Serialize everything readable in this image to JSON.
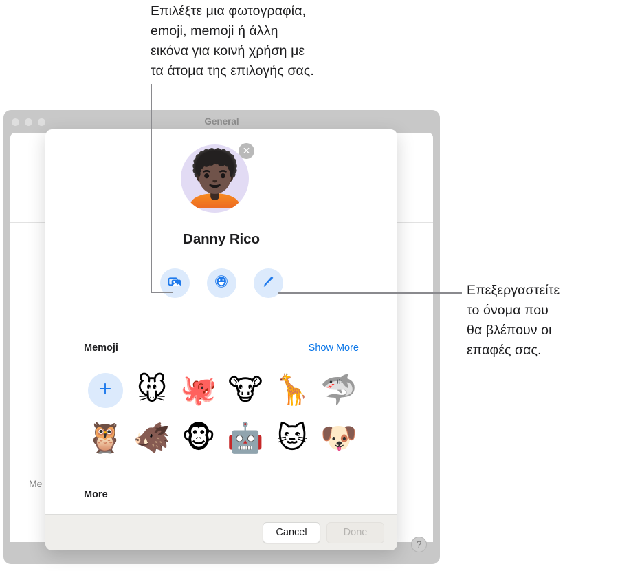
{
  "callouts": {
    "top": "Επιλέξτε μια φωτογραφία,\nemoji, memoji ή άλλη\nεικόνα για κοινή χρήση με\nτα άτομα της επιλογής σας.",
    "right": "Επεξεργαστείτε\nτο όνομα που\nθα βλέπουν οι\nεπαφές σας."
  },
  "background_window": {
    "title": "General",
    "me_label": "Me",
    "help_label": "?",
    "traffic_lights": [
      "close-dot",
      "minimize-dot",
      "maximize-dot"
    ]
  },
  "dialog": {
    "avatar": {
      "glyph": "🧑🏿‍🦱",
      "remove_label": "✕",
      "background_color": "#e2dbf4"
    },
    "profile_name": "Danny Rico",
    "actions": [
      {
        "name": "photos",
        "icon": "photos-icon"
      },
      {
        "name": "emoji",
        "icon": "smiley-icon"
      },
      {
        "name": "edit-name",
        "icon": "pencil-icon"
      }
    ],
    "memoji_section": {
      "title": "Memoji",
      "link": "Show More",
      "add_label": "+",
      "items": [
        {
          "name": "add-memoji",
          "glyph": ""
        },
        {
          "name": "memoji-mouse",
          "glyph": "🐭"
        },
        {
          "name": "memoji-octopus",
          "glyph": "🐙"
        },
        {
          "name": "memoji-cow",
          "glyph": "🐮"
        },
        {
          "name": "memoji-giraffe",
          "glyph": "🦒"
        },
        {
          "name": "memoji-shark",
          "glyph": "🦈"
        },
        {
          "name": "memoji-owl",
          "glyph": "🦉"
        },
        {
          "name": "memoji-boar",
          "glyph": "🐗"
        },
        {
          "name": "memoji-monkey",
          "glyph": "🐵"
        },
        {
          "name": "memoji-robot",
          "glyph": "🤖"
        },
        {
          "name": "memoji-cat",
          "glyph": "🐱"
        },
        {
          "name": "memoji-dog",
          "glyph": "🐶"
        }
      ]
    },
    "more_section": {
      "title": "More"
    },
    "footer": {
      "cancel_label": "Cancel",
      "done_label": "Done"
    }
  },
  "colors": {
    "accent_blue": "#0a76e8",
    "button_tint": "#dceafc",
    "window_chrome": "#c8c8c8",
    "footer_bar": "#efeeeb"
  }
}
